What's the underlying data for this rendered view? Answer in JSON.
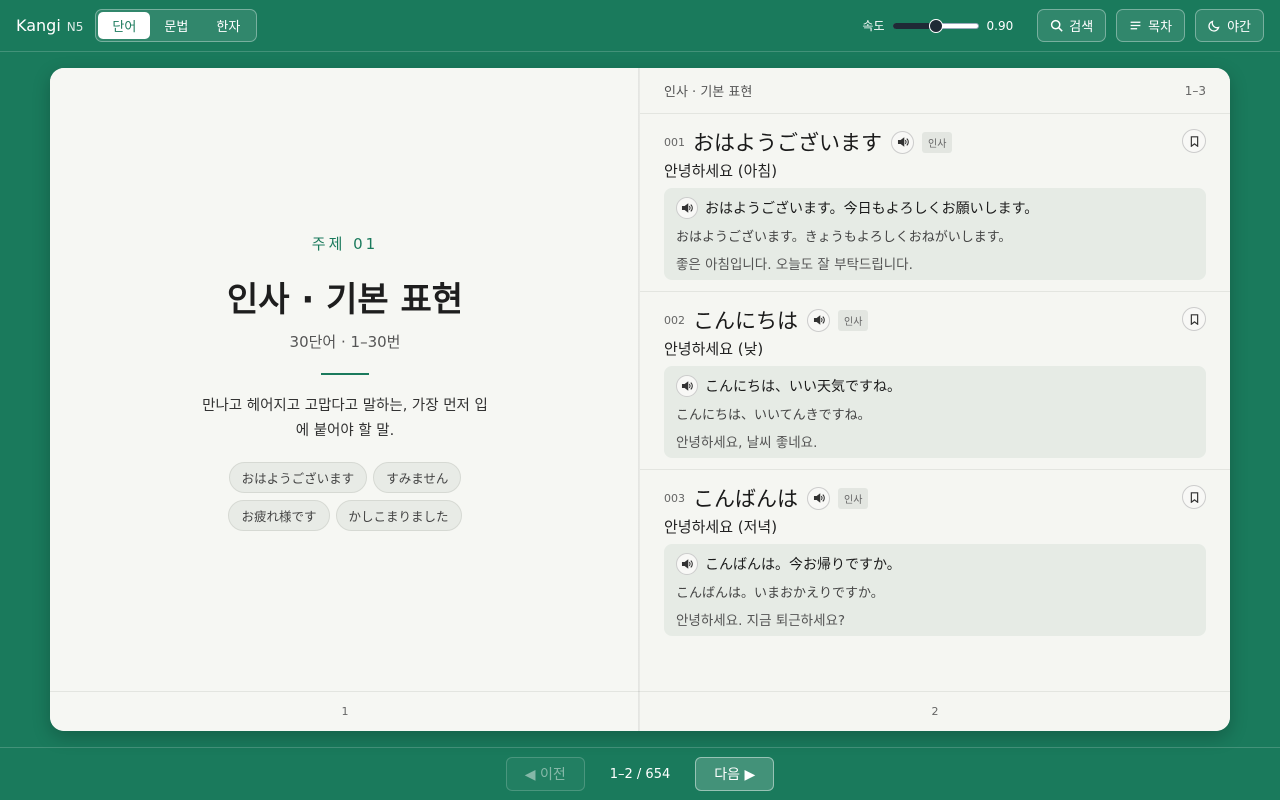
{
  "app": {
    "name": "Kangi",
    "level": "N5"
  },
  "tabs": [
    {
      "label": "단어",
      "active": true
    },
    {
      "label": "문법",
      "active": false
    },
    {
      "label": "한자",
      "active": false
    }
  ],
  "speed": {
    "label": "속도",
    "value": "0.90",
    "fraction": 0.5
  },
  "toolbar": {
    "search": "검색",
    "toc": "목차",
    "night": "야간"
  },
  "left_page": {
    "topic": "주제 01",
    "title": "인사 · 기본 표현",
    "subtitle": "30단어 · 1–30번",
    "description": "만나고 헤어지고 고맙다고 말하는, 가장 먼저 입에 붙어야 할 말.",
    "chips": [
      "おはようございます",
      "すみません",
      "お疲れ様です",
      "かしこまりました"
    ],
    "page_number": "1"
  },
  "right_page": {
    "header_title": "인사 · 기본 표현",
    "header_range": "1–3",
    "page_number": "2",
    "entries": [
      {
        "num": "001",
        "word": "おはようございます",
        "tag": "인사",
        "meaning": "안녕하세요 (아침)",
        "ex_jp": "おはようございます。今日もよろしくお願いします。",
        "ex_kana": "おはようございます。きょうもよろしくおねがいします。",
        "ex_ko": "좋은 아침입니다. 오늘도 잘 부탁드립니다."
      },
      {
        "num": "002",
        "word": "こんにちは",
        "tag": "인사",
        "meaning": "안녕하세요 (낮)",
        "ex_jp": "こんにちは、いい天気ですね。",
        "ex_kana": "こんにちは、いいてんきですね。",
        "ex_ko": "안녕하세요, 날씨 좋네요."
      },
      {
        "num": "003",
        "word": "こんばんは",
        "tag": "인사",
        "meaning": "안녕하세요 (저녁)",
        "ex_jp": "こんばんは。今お帰りですか。",
        "ex_kana": "こんばんは。いまおかえりですか。",
        "ex_ko": "안녕하세요. 지금 퇴근하세요?"
      }
    ]
  },
  "nav": {
    "prev": "◀ 이전",
    "page_info": "1–2 / 654",
    "next": "다음 ▶"
  },
  "colors": {
    "accent": "#1a7a5c",
    "paper": "#f5f6f2",
    "example_bg": "#e6ebe5"
  }
}
